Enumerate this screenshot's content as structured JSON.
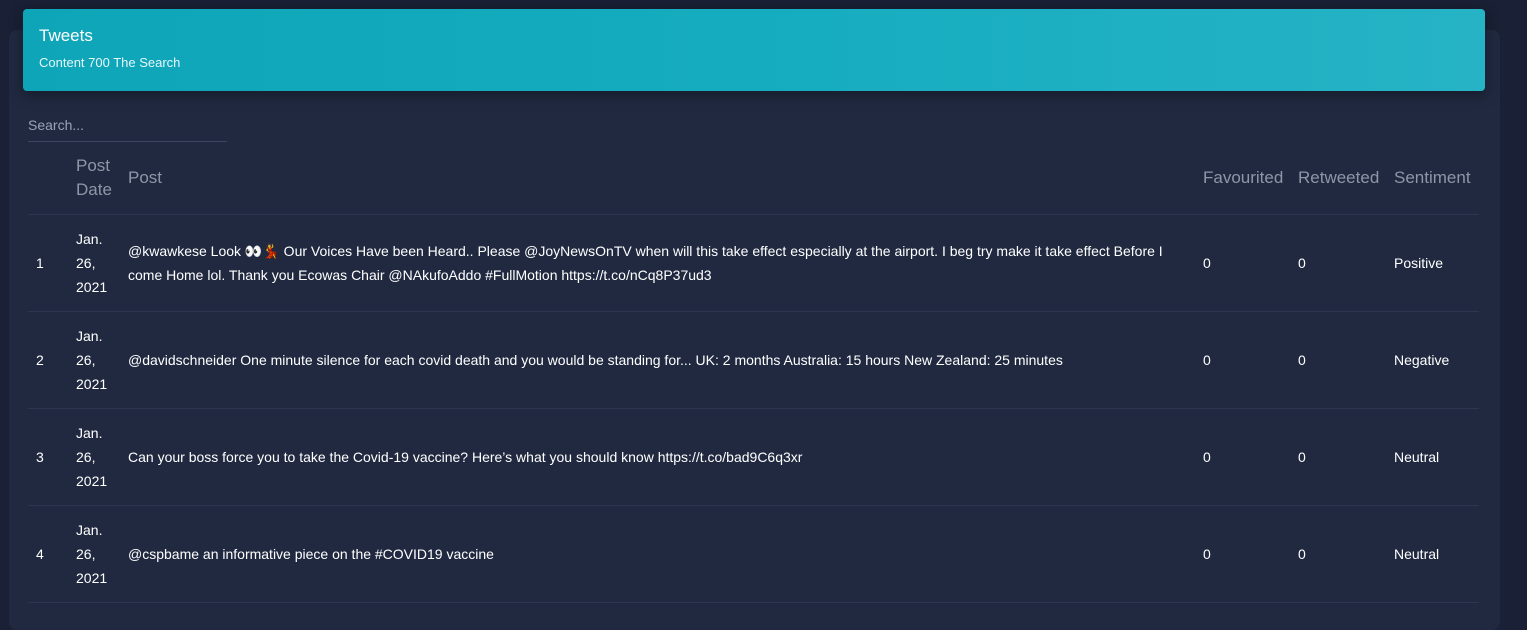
{
  "header": {
    "title": "Tweets",
    "subtitle": "Content 700 The Search"
  },
  "search": {
    "placeholder": "Search...",
    "value": ""
  },
  "table": {
    "columns": [
      "",
      "Post Date",
      "Post",
      "Favourited",
      "Retweeted",
      "Sentiment"
    ],
    "rows": [
      {
        "index": "1",
        "date": "Jan. 26, 2021",
        "post": "@kwawkese Look 👀💃 Our Voices Have been Heard.. Please @JoyNewsOnTV when will this take effect especially at the airport. I beg try make it take effect Before I come Home lol. Thank you Ecowas Chair @NAkufoAddo #FullMotion https://t.co/nCq8P37ud3",
        "favourited": "0",
        "retweeted": "0",
        "sentiment": "Positive"
      },
      {
        "index": "2",
        "date": "Jan. 26, 2021",
        "post": "@davidschneider One minute silence for each covid death and you would be standing for... UK: 2 months Australia: 15 hours New Zealand: 25 minutes",
        "favourited": "0",
        "retweeted": "0",
        "sentiment": "Negative"
      },
      {
        "index": "3",
        "date": "Jan. 26, 2021",
        "post": "Can your boss force you to take the Covid-19 vaccine? Here’s what you should know https://t.co/bad9C6q3xr",
        "favourited": "0",
        "retweeted": "0",
        "sentiment": "Neutral"
      },
      {
        "index": "4",
        "date": "Jan. 26, 2021",
        "post": "@cspbame an informative piece on the #COVID19 vaccine",
        "favourited": "0",
        "retweeted": "0",
        "sentiment": "Neutral"
      }
    ]
  },
  "colors": {
    "page_background": "#1a2035",
    "card_background": "#202940",
    "header_gradient_start": "#0ea5b8",
    "header_gradient_end": "#26b3c6",
    "header_text": "#8f96a8"
  }
}
